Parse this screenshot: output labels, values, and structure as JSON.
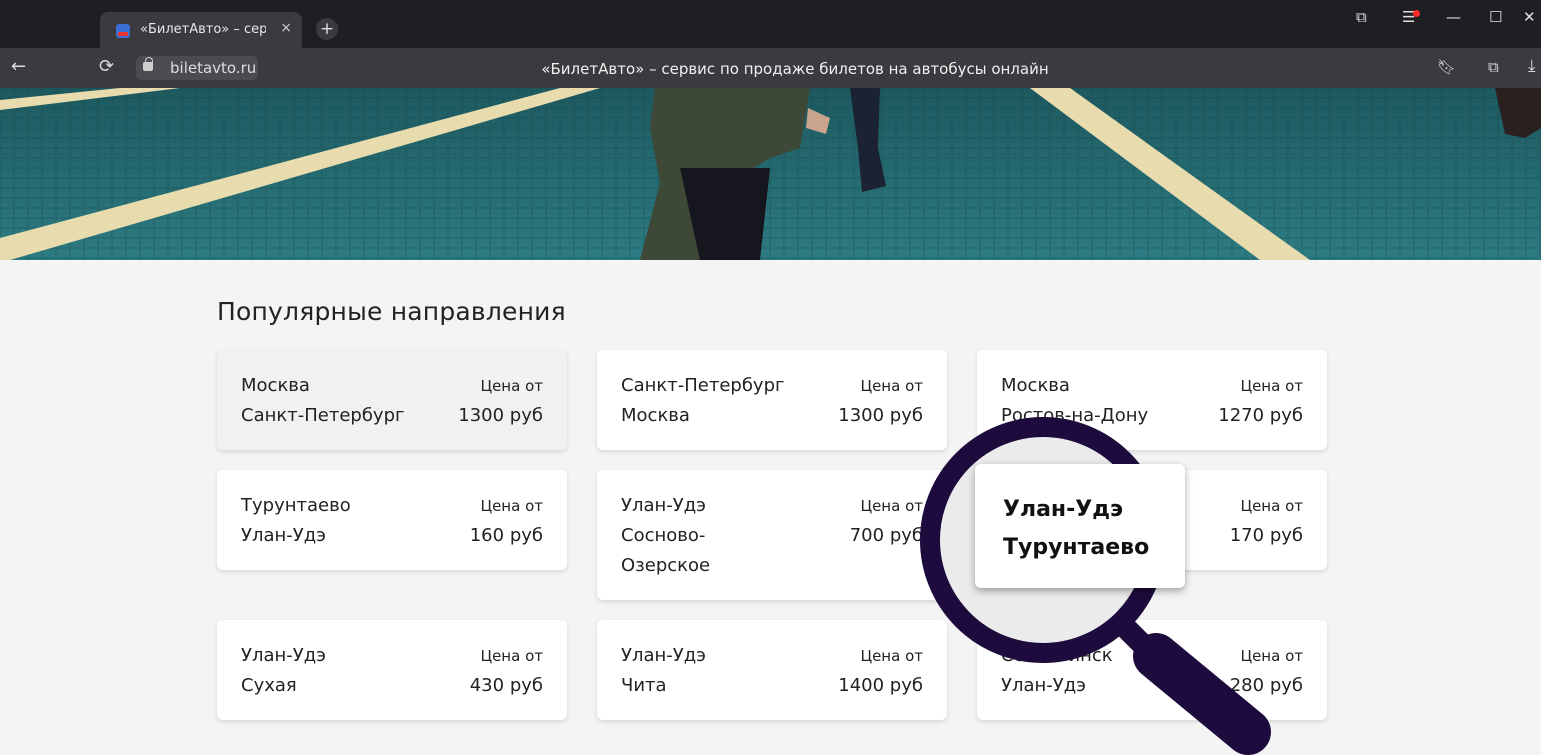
{
  "browser": {
    "tab_title": "«БилетАвто» – сервис п",
    "tab_close": "×",
    "new_tab": "+",
    "back": "←",
    "reload": "⟳",
    "url": "biletavto.ru",
    "page_title": "«БилетАвто» – сервис по продаже билетов на автобусы онлайн"
  },
  "section": {
    "title": "Популярные направления"
  },
  "routes": [
    {
      "from": "Москва",
      "to": "Санкт-Петербург",
      "price_label": "Цена от",
      "price": "1300 руб"
    },
    {
      "from": "Санкт-Петербург",
      "to": "Москва",
      "price_label": "Цена от",
      "price": "1300 руб"
    },
    {
      "from": "Москва",
      "to": "Ростов-на-Дону",
      "price_label": "Цена от",
      "price": "1270 руб"
    },
    {
      "from": "Турунтаево",
      "to": "Улан-Удэ",
      "price_label": "Цена от",
      "price": "160 руб"
    },
    {
      "from": "Улан-Удэ",
      "to": "Сосново-",
      "to2": "Озерское",
      "price_label": "Цена от",
      "price": "700 руб"
    },
    {
      "from": "Улан-Удэ",
      "to": "Турунтаево",
      "price_label": "Цена от",
      "price": "170 руб"
    },
    {
      "from": "Улан-Удэ",
      "to": "Сухая",
      "price_label": "Цена от",
      "price": "430 руб"
    },
    {
      "from": "Улан-Удэ",
      "to": "Чита",
      "price_label": "Цена от",
      "price": "1400 руб"
    },
    {
      "from": "Селенгинск",
      "to": "Улан-Удэ",
      "price_label": "Цена от",
      "price": "280 руб"
    }
  ],
  "colors": {
    "accent_dark": "#1e0b3d",
    "hero_teal": "#1e5d64",
    "page_bg": "#f4f4f4"
  }
}
